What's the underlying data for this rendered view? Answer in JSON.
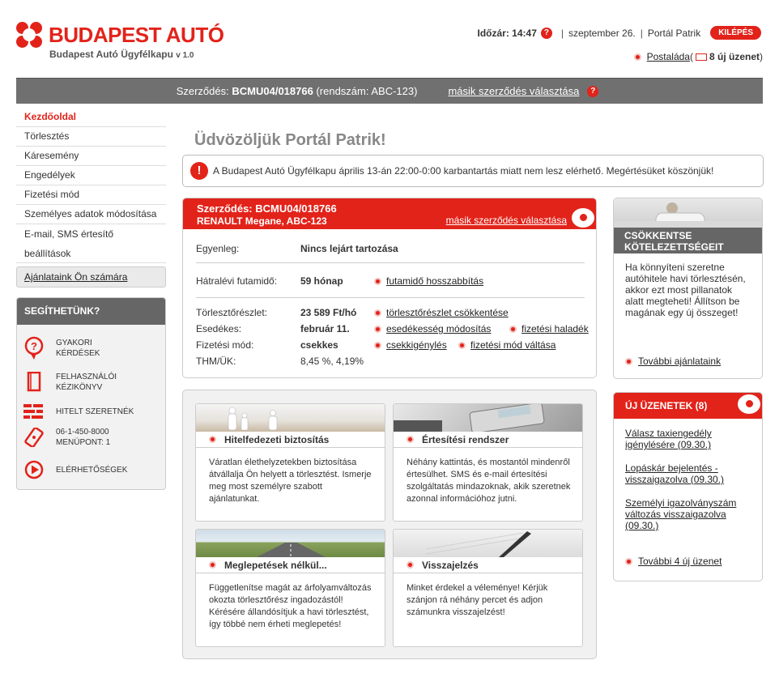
{
  "header": {
    "brand": "BUDAPEST AUTÓ",
    "subtitle": "Budapest Autó Ügyfélkapu",
    "version": "v 1.0",
    "timer_label": "Időzár: 14:47",
    "date": "szeptember 26.",
    "portal_user": "Portál Patrik",
    "logout": "KILÉPÉS",
    "mailbox": "Postaláda",
    "new_messages": "8 új üzenet"
  },
  "contract_bar": {
    "label": "Szerződés:",
    "number": "BCMU04/018766",
    "plate": "(rendszám: ABC-123)",
    "change_link": "másik szerződés választása"
  },
  "nav": {
    "items": [
      "Kezdőoldal",
      "Törlesztés",
      "Káresemény",
      "Engedélyek",
      "Fizetési mód",
      "Személyes adatok módosítása"
    ],
    "email_sms_1": "E-mail, SMS értesítő",
    "email_sms_2": "beállítások",
    "offers": "Ajánlataink Ön számára"
  },
  "help": {
    "title": "SEGÍTHETÜNK?",
    "faq_1": "GYAKORI",
    "faq_2": "KÉRDÉSEK",
    "manual_1": "FELHASZNÁLÓI",
    "manual_2": "KÉZIKÖNYV",
    "loan": "HITELT SZERETNÉK",
    "phone_1": "06-1-450-8000",
    "phone_2": "MENÜPONT: 1",
    "contacts": "ELÉRHETŐSÉGEK"
  },
  "main": {
    "welcome": "Üdvözöljük Portál Patrik!",
    "notice": "A Budapest Autó Ügyfélkapu április 13-án 22:00-0:00 karbantartás miatt nem lesz elérhető. Megértésüket köszönjük!"
  },
  "contract": {
    "title": "Szerződés: BCMU04/018766",
    "car": "RENAULT Megane, ABC-123",
    "change_link": "másik szerződés választása",
    "balance_label": "Egyenleg:",
    "balance_value": "Nincs lejárt tartozása",
    "term_label": "Hátralévi futamidő:",
    "term_value": "59 hónap",
    "term_action": "futamidő hosszabbítás",
    "installment_label": "Törlesztőrészlet:",
    "installment_value": "23 589 Ft/hó",
    "installment_action": "törlesztőrészlet csökkentése",
    "due_label": "Esedékes:",
    "due_value": "február 11.",
    "due_action": "esedékesség módosítás",
    "delay_action": "fizetési haladék",
    "payment_label": "Fizetési mód:",
    "payment_value": "csekkes",
    "cheque_action": "csekkigénylés",
    "payment_change_action": "fizetési mód váltása",
    "thm_label": "THM/ÜK:",
    "thm_value": "8,45 %, 4,19%"
  },
  "offers": [
    {
      "title": "Hitelfedezeti biztosítás",
      "text": "Váratlan élethelyzetekben biztosítása átvállalja Ön helyett a törlesztést. Ismerje meg most személyre szabott ajánlatunkat."
    },
    {
      "title": "Értesítési rendszer",
      "text": "Néhány kattintás, és mostantól mindenről értesülhet. SMS és e-mail értesítési szolgáltatás mindazoknak, akik szeretnek azonnal információhoz jutni."
    },
    {
      "title": "Meglepetések nélkül...",
      "text": "Függetlenítse magát az árfolyamváltozás okozta törlesztőrész ingadozástól! Kérésére állandósítjuk a havi törlesztést, így többé nem érheti meglepetés!"
    },
    {
      "title": "Visszajelzés",
      "text": "Minket érdekel a véleménye! Kérjük szánjon rá néhány percet és adjon számunkra visszajelzést!"
    }
  ],
  "side_offer": {
    "title_1": "CSÖKKENTSE",
    "title_2": "KÖTELEZETTSÉGEIT",
    "text": "Ha könnyíteni szeretne autóhitele havi törlesztésén, akkor ezt most pillanatok alatt megteheti! Állítson be magának egy új összeget!",
    "more": "További ajánlataink"
  },
  "side_messages": {
    "title": "ÚJ ÜZENETEK (8)",
    "items": [
      "Válasz taxiengedély igénylésére (09.30.)",
      "Lopáskár bejelentés - visszaigazolva (09.30.)",
      "Személyi igazolványszám változás visszaigazolva (09.30.)"
    ],
    "more": "További 4 új üzenet"
  },
  "colors": {
    "brand_red": "#e2231a",
    "bar_grey": "#707070"
  }
}
